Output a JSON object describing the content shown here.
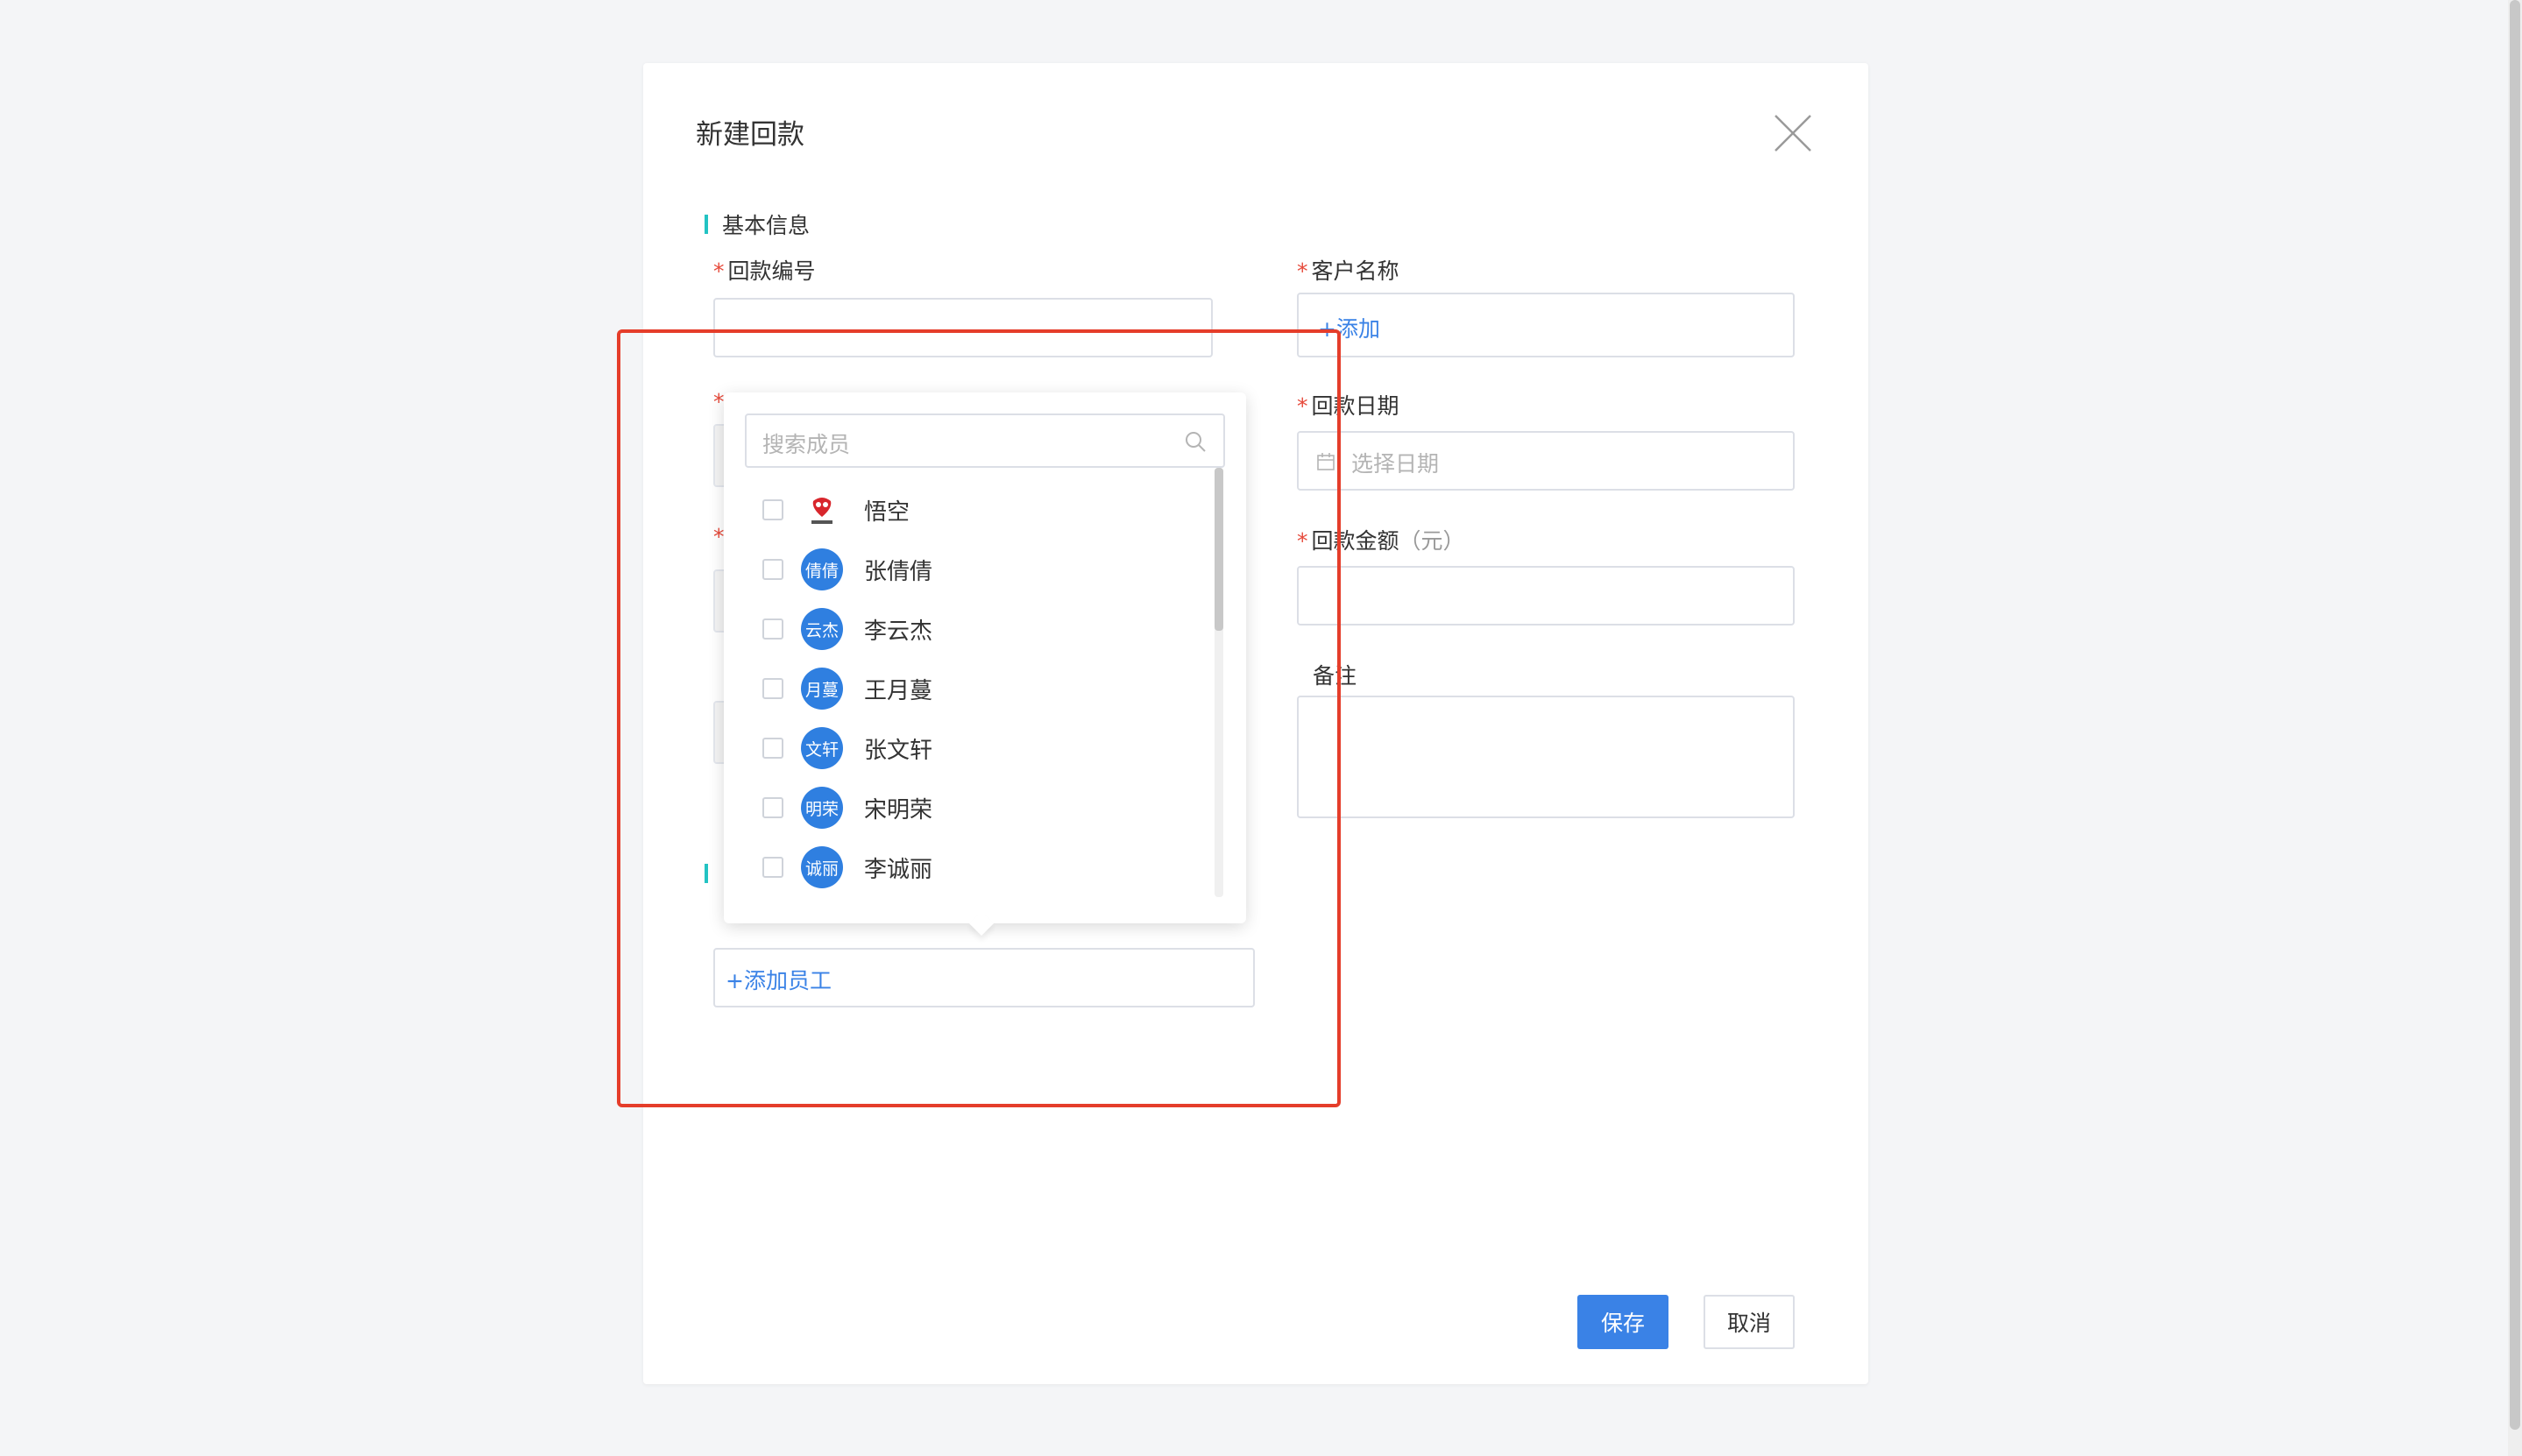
{
  "dialog": {
    "title": "新建回款"
  },
  "sections": {
    "basic_info": "基本信息"
  },
  "fields": {
    "payment_number": {
      "label": "回款编号",
      "value": ""
    },
    "customer_name": {
      "label": "客户名称",
      "add_label": "+添加"
    },
    "payment_date": {
      "label": "回款日期",
      "placeholder": "选择日期"
    },
    "payment_amount": {
      "label": "回款金额",
      "unit": "（元）",
      "value": ""
    },
    "remark": {
      "label": "备注",
      "value": ""
    },
    "employee": {
      "add_label": "+添加员工"
    }
  },
  "member_picker": {
    "search_placeholder": "搜索成员",
    "members": [
      {
        "name": "悟空",
        "avatar_text": "",
        "avatar_type": "logo"
      },
      {
        "name": "张倩倩",
        "avatar_text": "倩倩"
      },
      {
        "name": "李云杰",
        "avatar_text": "云杰"
      },
      {
        "name": "王月蔓",
        "avatar_text": "月蔓"
      },
      {
        "name": "张文轩",
        "avatar_text": "文轩"
      },
      {
        "name": "宋明荣",
        "avatar_text": "明荣"
      },
      {
        "name": "李诚丽",
        "avatar_text": "诚丽"
      }
    ]
  },
  "buttons": {
    "save": "保存",
    "cancel": "取消"
  },
  "colors": {
    "primary": "#3a82e6",
    "required": "#e64a3b",
    "section_accent": "#23c3c3",
    "highlight": "#e53d2a",
    "avatar": "#2f7fe0"
  }
}
